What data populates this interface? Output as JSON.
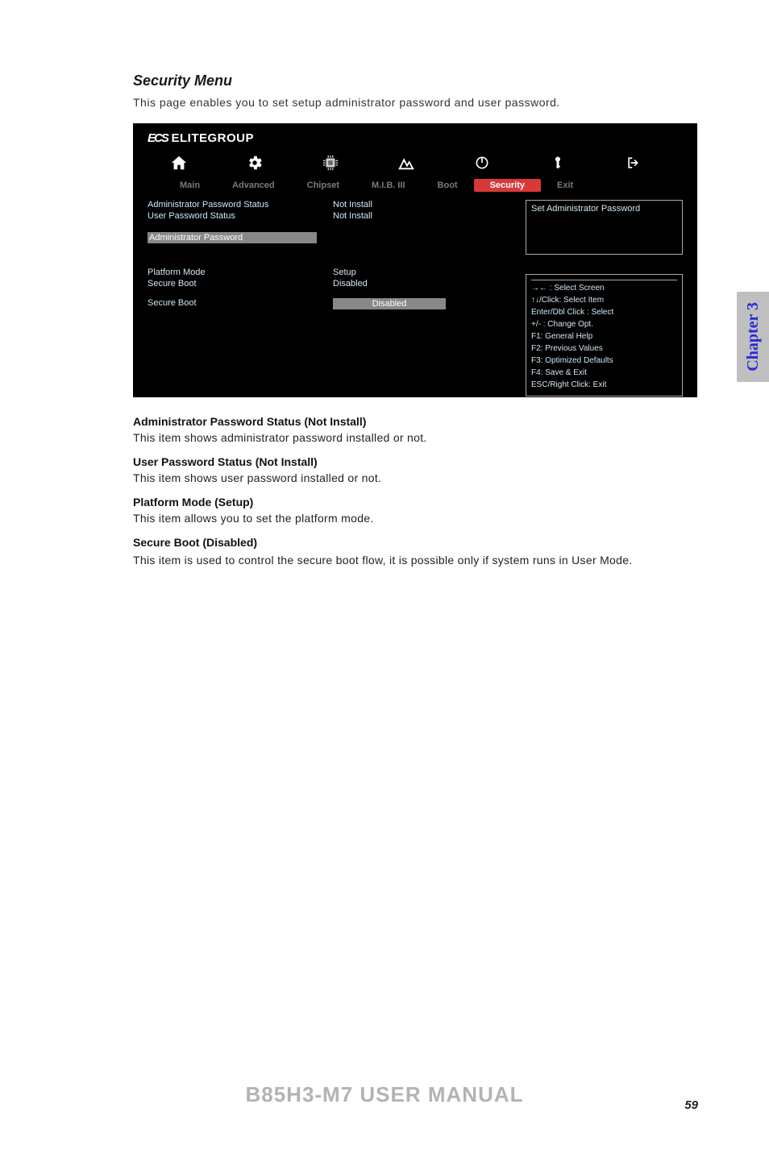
{
  "page": {
    "sectionTitle": "Security Menu",
    "intro": "This page enables you to set setup administrator password and user password.",
    "footerTitle": "B85H3-M7 USER MANUAL",
    "pageNumber": "59",
    "sideTab": "Chapter 3"
  },
  "bios": {
    "brand": "ELITEGROUP",
    "brandPrefix": "ECS",
    "tabs": {
      "main": "Main",
      "advanced": "Advanced",
      "chipset": "Chipset",
      "mib": "M.I.B. III",
      "boot": "Boot",
      "security": "Security",
      "exit": "Exit"
    },
    "status": {
      "adminPwLabel": "Administrator Password Status",
      "adminPwValue": "Not Install",
      "userPwLabel": "User Password Status",
      "userPwValue": "Not Install"
    },
    "adminPasswordRow": "Administrator  Password",
    "platform": {
      "modeLabel": "Platform Mode",
      "modeValue": "Setup",
      "secureBootLabel": "Secure Boot",
      "secureBootValue": "Disabled",
      "secureBootSelectLabel": "Secure Boot",
      "secureBootSelectValue": "Disabled"
    },
    "rightBox1": "Set Administrator Password",
    "help": {
      "l1": "→←   : Select Screen",
      "l2": "↑↓/Click: Select Item",
      "l3": "Enter/Dbl Click : Select",
      "l4": "+/- : Change Opt.",
      "l5": "F1: General Help",
      "l6": "F2: Previous Values",
      "l7": "F3: Optimized Defaults",
      "l8": "F4: Save & Exit",
      "l9": "ESC/Right Click: Exit"
    }
  },
  "descriptions": {
    "d1h": "Administrator Password Status (Not Install)",
    "d1t": "This item shows administrator password installed or not.",
    "d2h": "User Password Status (Not Install)",
    "d2t": "This item shows user password installed or not.",
    "d3h": "Platform Mode (Setup)",
    "d3t": "This item allows you to set the platform mode.",
    "d4h": "Secure Boot (Disabled)",
    "d4t": "This item is used to control the secure boot flow, it is possible only if system runs in User Mode."
  }
}
